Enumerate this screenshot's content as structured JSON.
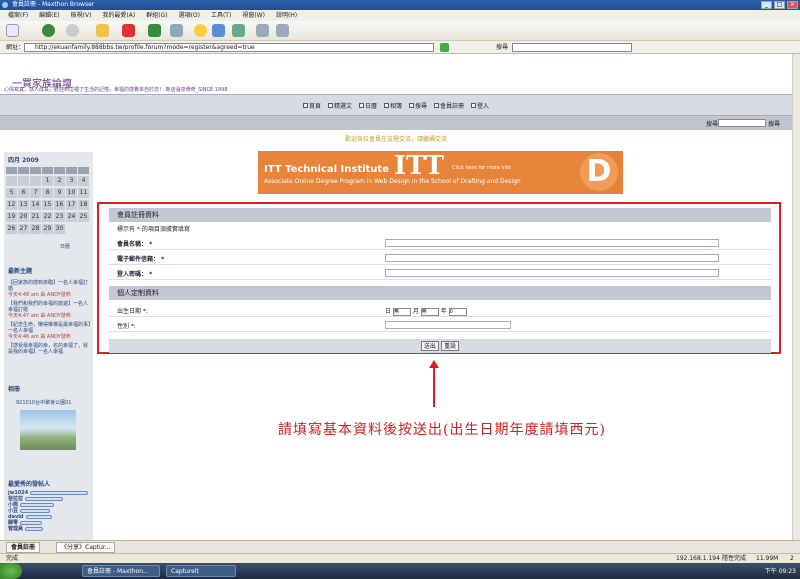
{
  "window": {
    "title": "會員註冊 - Maxthon Browser"
  },
  "menu": [
    "檔案(F)",
    "編輯(E)",
    "檢視(V)",
    "我的最愛(A)",
    "群組(G)",
    "選項(O)",
    "工具(T)",
    "視窗(W)",
    "說明(H)"
  ],
  "address": {
    "label": "網址：",
    "url": "http://ekuanfamily.888bbs.tw/profile.forum?mode=register&agreed=true",
    "search_label": "搜尋",
    "search_value": ""
  },
  "site": {
    "name": "一買家族論壇",
    "slogan": "心情寫真，感人成長，歡迎到這裡了生活的記憶，幸福的感覺來自於您！ 新店溫泉傳奇_SINCE 1998"
  },
  "nav": [
    "首頁",
    "精選文",
    "日曆",
    "相簿",
    "搜尋",
    "會員註冊",
    "登入"
  ],
  "search": {
    "label": "搜尋",
    "button": "搜尋"
  },
  "notice": "歡迎各位會員在這裡交流，請繼續交流",
  "banner": {
    "title": "ITT Technical Institute",
    "logo": "ITT",
    "link": "Click here for more info",
    "subtitle": "Associate Online Degree Program in Web Design in the School of Drafting and Design",
    "letter": "D"
  },
  "calendar": {
    "title": "四月 2009",
    "rows": [
      [
        "",
        "",
        "",
        "",
        "",
        "",
        ""
      ],
      [
        "",
        "",
        "",
        "1",
        "2",
        "3",
        "4"
      ],
      [
        "5",
        "6",
        "7",
        "8",
        "9",
        "10",
        "11"
      ],
      [
        "12",
        "13",
        "14",
        "15",
        "16",
        "17",
        "18"
      ],
      [
        "19",
        "20",
        "21",
        "22",
        "23",
        "24",
        "25"
      ],
      [
        "26",
        "27",
        "28",
        "29",
        "30",
        "",
        ""
      ]
    ],
    "footer": "日曆"
  },
  "latest": {
    "title": "最新主題",
    "items": [
      {
        "text": "【回家族的感到來臨】一名人幸福訂婚",
        "meta": "今天4:48 am 由 ANDY發佈"
      },
      {
        "text": "【我們和我們的幸福的旅遊】一名人幸福訂婚",
        "meta": "今天4:47 am 由 ANDY發佈"
      },
      {
        "text": "【紀念生命，賺得推推是最幸福的事】一名人幸福",
        "meta": "今天4:46 am 由 ANDY發佈"
      },
      {
        "text": "【感受最幸福的幸，名的幸福了，就是我的幸福】一名人幸福",
        "meta": ""
      }
    ]
  },
  "album": {
    "title": "相冊",
    "caption": "921010台中聚會公園01"
  },
  "active": {
    "title": "最愛秀的發帖人",
    "users": [
      "jw1024",
      "爸拉拉",
      "小熊",
      "小豆",
      "david",
      "歸零",
      "管理員"
    ]
  },
  "form": {
    "section1": "會員註冊資料",
    "required_note": "標示有 * 的項目須據實填寫",
    "fields": [
      {
        "label": "會員名稱： *"
      },
      {
        "label": "電子郵件信箱： *"
      },
      {
        "label": "登入密碼： *"
      }
    ],
    "section2": "個人定制資料",
    "birthday": {
      "label": "出生日期 *:",
      "day_prefix": "日",
      "day_value": "無",
      "month_prefix": "月",
      "month_value": "無",
      "year_prefix": "年",
      "year_value": "0"
    },
    "gender_label": "性別 *:",
    "submit": "送出",
    "reset": "重設"
  },
  "annotation": "請填寫基本資料後按送出(出生日期年度請填西元)",
  "tabs": [
    "會員註冊",
    "《分享》Captur..."
  ],
  "status": {
    "left": "完成",
    "ip": "192.168.1.194",
    "mode": "隱性完成",
    "mem": "11.99M",
    "num": "2"
  },
  "taskbar": {
    "items": [
      "會員註冊 - Maxthon...",
      "Capturelt"
    ],
    "clock": "下午 09:23"
  }
}
